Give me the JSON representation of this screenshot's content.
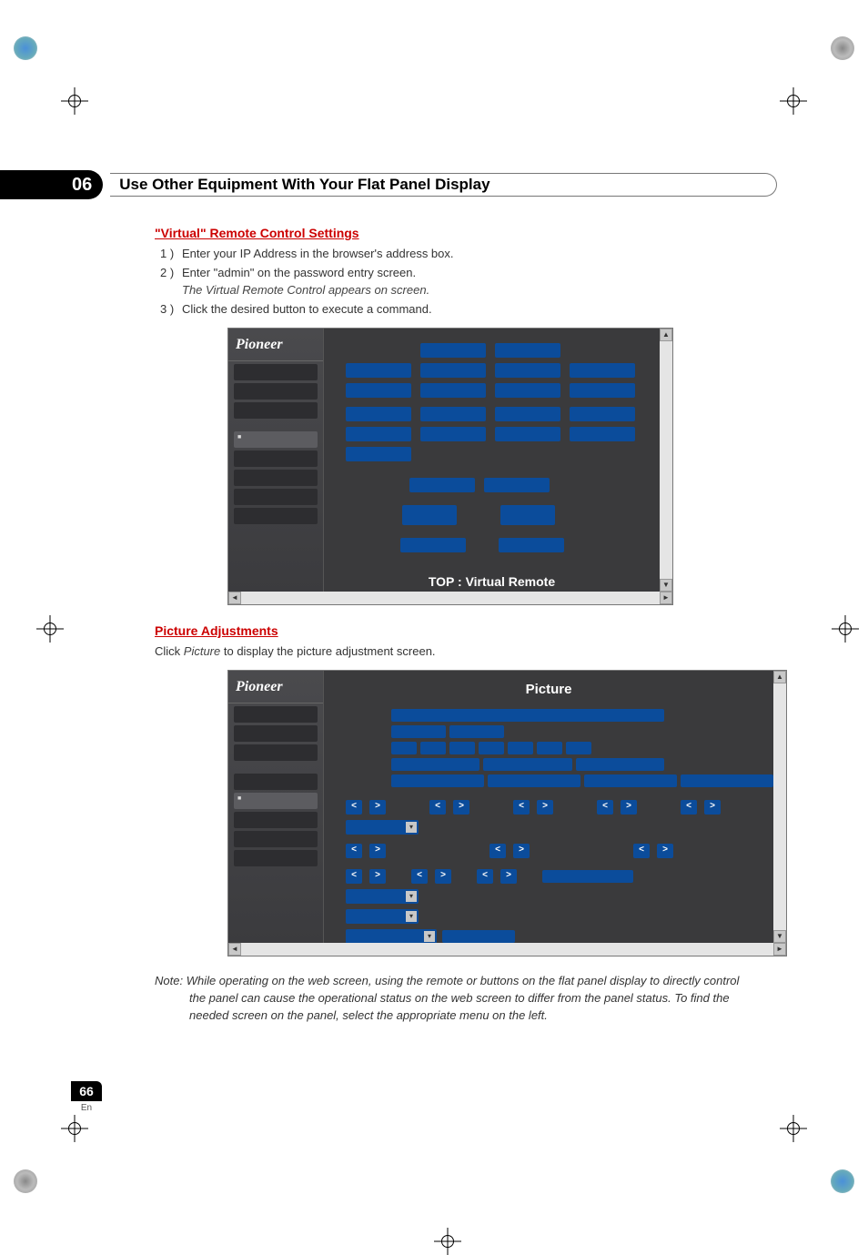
{
  "chapter": {
    "number": "06",
    "title": "Use Other Equipment With Your Flat Panel Display"
  },
  "section1": {
    "heading": "\"Virtual\" Remote Control Settings",
    "steps": [
      {
        "n": "1 )",
        "text": "Enter your IP Address in the browser's address box."
      },
      {
        "n": "2 )",
        "text": "Enter \"admin\" on the password entry screen.",
        "sub": "The Virtual Remote Control appears on screen."
      },
      {
        "n": "3 )",
        "text": "Click the desired button to execute a command."
      }
    ]
  },
  "screenshot1": {
    "logo": "Pioneer",
    "bottom_label": "TOP : Virtual Remote"
  },
  "section2": {
    "heading": "Picture Adjustments",
    "intro_pre": "Click ",
    "intro_em": "Picture",
    "intro_post": " to display the picture adjustment screen."
  },
  "screenshot2": {
    "logo": "Pioneer",
    "title": "Picture",
    "lt": "<",
    "gt": ">",
    "dd": "▾"
  },
  "note": {
    "label": "Note: ",
    "line1": "While operating on the web screen, using the remote or buttons on the flat panel display to directly control",
    "line2": "the panel can cause the operational status on the web screen to differ from the panel status. To find the",
    "line3": "needed screen on the panel, select the appropriate menu on the left."
  },
  "pagenum": {
    "num": "66",
    "lang": "En"
  },
  "marks": {
    "tri_l": "◄",
    "tri_r": "►",
    "tri_u": "▲",
    "tri_d": "▼"
  }
}
